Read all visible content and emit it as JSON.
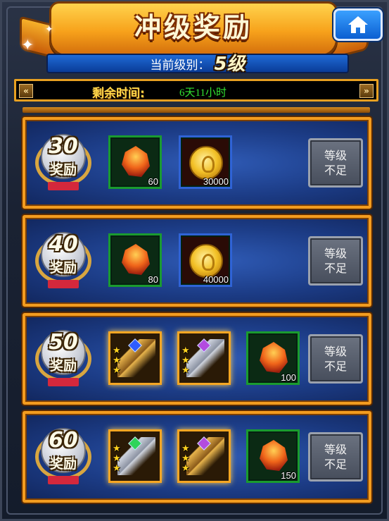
{
  "header": {
    "title": "冲级奖励",
    "home_button_icon": "home-icon"
  },
  "level": {
    "label": "当前级别：",
    "value": "5级"
  },
  "timer": {
    "label": "剩余时间:",
    "value": "6天11小时"
  },
  "rewards": [
    {
      "level": "30",
      "badge_text": "奖励",
      "items": [
        {
          "icon": "ore-icon",
          "count": "60",
          "frame": "green"
        },
        {
          "icon": "gold-coin-icon",
          "count": "30000",
          "frame": "blue"
        }
      ],
      "status": "等级不足"
    },
    {
      "level": "40",
      "badge_text": "奖励",
      "items": [
        {
          "icon": "ore-icon",
          "count": "80",
          "frame": "green"
        },
        {
          "icon": "gold-coin-icon",
          "count": "40000",
          "frame": "blue"
        }
      ],
      "status": "等级不足"
    },
    {
      "level": "50",
      "badge_text": "奖励",
      "items": [
        {
          "icon": "weapon-blue-gem-icon",
          "count": "",
          "frame": "orange",
          "stars": 3
        },
        {
          "icon": "amulet-purple-gem-icon",
          "count": "",
          "frame": "orange",
          "stars": 3
        },
        {
          "icon": "ore-icon",
          "count": "100",
          "frame": "green"
        }
      ],
      "status": "等级不足"
    },
    {
      "level": "60",
      "badge_text": "奖励",
      "items": [
        {
          "icon": "sword-green-gem-icon",
          "count": "",
          "frame": "orange",
          "stars": 3
        },
        {
          "icon": "staff-purple-gem-icon",
          "count": "",
          "frame": "orange",
          "stars": 3
        },
        {
          "icon": "ore-icon",
          "count": "150",
          "frame": "green"
        }
      ],
      "status": "等级不足"
    }
  ],
  "colors": {
    "panel_border": "#f39c1f",
    "panel_bg": "#1c3c86",
    "timer_value": "#32e332",
    "timer_label": "#ffd84a"
  }
}
